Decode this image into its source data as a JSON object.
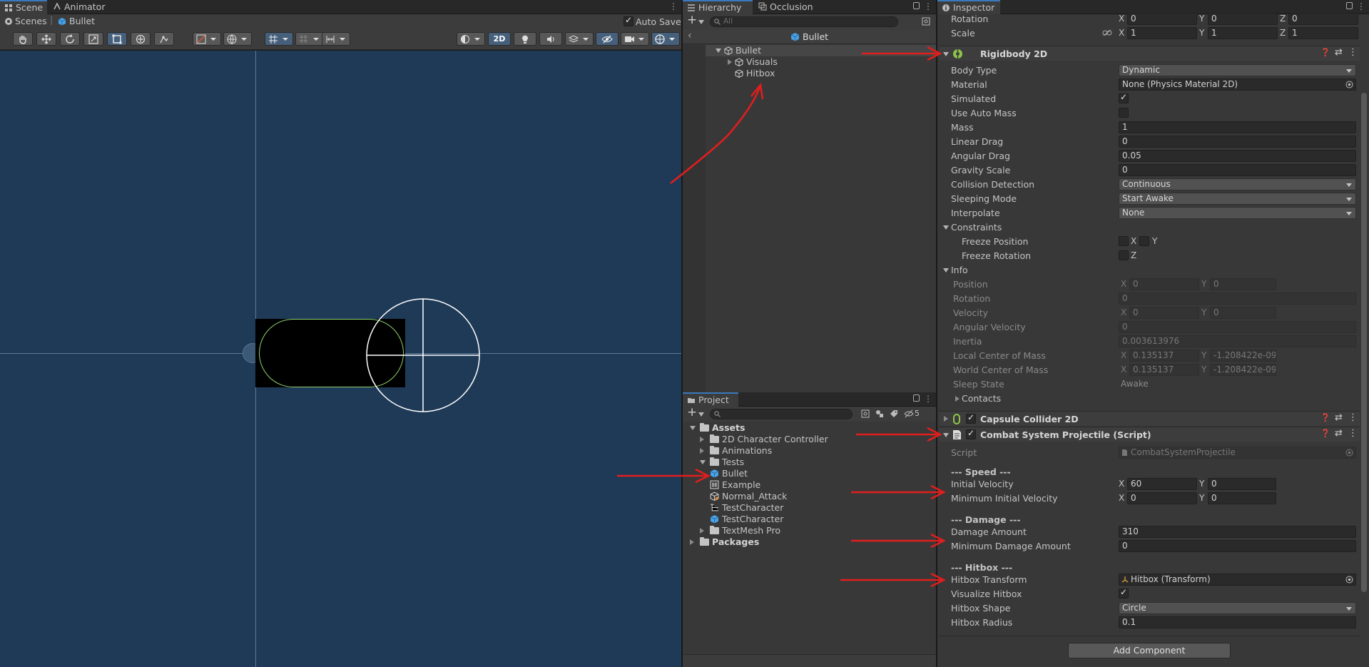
{
  "scene": {
    "tabs": [
      {
        "label": "Scene"
      },
      {
        "label": "Animator"
      }
    ],
    "breadcrumb": {
      "root": "Scenes",
      "item": "Bullet"
    },
    "auto_save_label": "Auto Save",
    "mode_2d": "2D"
  },
  "hierarchy": {
    "tabs": [
      {
        "label": "Hierarchy"
      },
      {
        "label": "Occlusion"
      }
    ],
    "search_placeholder": "All",
    "header": "Bullet",
    "items": [
      {
        "label": "Bullet"
      },
      {
        "label": "Visuals"
      },
      {
        "label": "Hitbox"
      }
    ]
  },
  "project": {
    "tab": "Project",
    "hidden_count": "5",
    "tree": {
      "assets": "Assets",
      "folders": [
        "2D Character Controller",
        "Animations"
      ],
      "tests": "Tests",
      "test_items": [
        "Bullet",
        "Example",
        "Normal_Attack",
        "TestCharacter",
        "TestCharacter"
      ],
      "textmesh": "TextMesh Pro",
      "packages": "Packages"
    }
  },
  "inspector": {
    "tab": "Inspector",
    "transform": {
      "rotation": {
        "label": "Rotation",
        "x": "0",
        "y": "0",
        "z": "0"
      },
      "scale": {
        "label": "Scale",
        "x": "1",
        "y": "1",
        "z": "1"
      }
    },
    "rigidbody": {
      "title": "Rigidbody 2D",
      "body_type": {
        "label": "Body Type",
        "value": "Dynamic"
      },
      "material": {
        "label": "Material",
        "value": "None (Physics Material 2D)"
      },
      "simulated": {
        "label": "Simulated",
        "checked": true
      },
      "use_auto_mass": {
        "label": "Use Auto Mass",
        "checked": false
      },
      "mass": {
        "label": "Mass",
        "value": "1"
      },
      "linear_drag": {
        "label": "Linear Drag",
        "value": "0"
      },
      "angular_drag": {
        "label": "Angular Drag",
        "value": "0.05"
      },
      "gravity_scale": {
        "label": "Gravity Scale",
        "value": "0"
      },
      "collision_detection": {
        "label": "Collision Detection",
        "value": "Continuous"
      },
      "sleeping_mode": {
        "label": "Sleeping Mode",
        "value": "Start Awake"
      },
      "interpolate": {
        "label": "Interpolate",
        "value": "None"
      },
      "constraints": "Constraints",
      "freeze_position": "Freeze Position",
      "freeze_rotation": "Freeze Rotation",
      "info": {
        "label": "Info",
        "position": {
          "label": "Position",
          "x": "0",
          "y": "0"
        },
        "rotation": {
          "label": "Rotation",
          "value": "0"
        },
        "velocity": {
          "label": "Velocity",
          "x": "0",
          "y": "0"
        },
        "angular_velocity": {
          "label": "Angular Velocity",
          "value": "0"
        },
        "inertia": {
          "label": "Inertia",
          "value": "0.003613976"
        },
        "local_com": {
          "label": "Local Center of Mass",
          "x": "0.135137",
          "y": "-1.208422e-09"
        },
        "world_com": {
          "label": "World Center of Mass",
          "x": "0.135137",
          "y": "-1.208422e-09"
        },
        "sleep_state": {
          "label": "Sleep State",
          "value": "Awake"
        },
        "contacts": "Contacts"
      }
    },
    "capsule": {
      "title": "Capsule Collider 2D"
    },
    "combat": {
      "title": "Combat System Projectile (Script)",
      "script": {
        "label": "Script",
        "value": "CombatSystemProjectile"
      },
      "speed_header": "--- Speed ---",
      "initial_velocity": {
        "label": "Initial Velocity",
        "x": "60",
        "y": "0"
      },
      "min_initial_velocity": {
        "label": "Minimum Initial Velocity",
        "x": "0",
        "y": "0"
      },
      "damage_header": "--- Damage ---",
      "damage_amount": {
        "label": "Damage Amount",
        "value": "310"
      },
      "min_damage_amount": {
        "label": "Minimum Damage Amount",
        "value": "0"
      },
      "hitbox_header": "--- Hitbox ---",
      "hitbox_transform": {
        "label": "Hitbox Transform",
        "value": "Hitbox (Transform)"
      },
      "visualize_hitbox": {
        "label": "Visualize Hitbox",
        "checked": true
      },
      "hitbox_shape": {
        "label": "Hitbox Shape",
        "value": "Circle"
      },
      "hitbox_radius": {
        "label": "Hitbox Radius",
        "value": "0.1"
      }
    },
    "add_component": "Add Component"
  },
  "axes": {
    "x": "X",
    "y": "Y",
    "z": "Z"
  },
  "colors": {
    "scene_bg": "#1f3a57",
    "accent": "#3a79bb",
    "annotation": "#e01e1e",
    "collider": "#8fd36e"
  }
}
